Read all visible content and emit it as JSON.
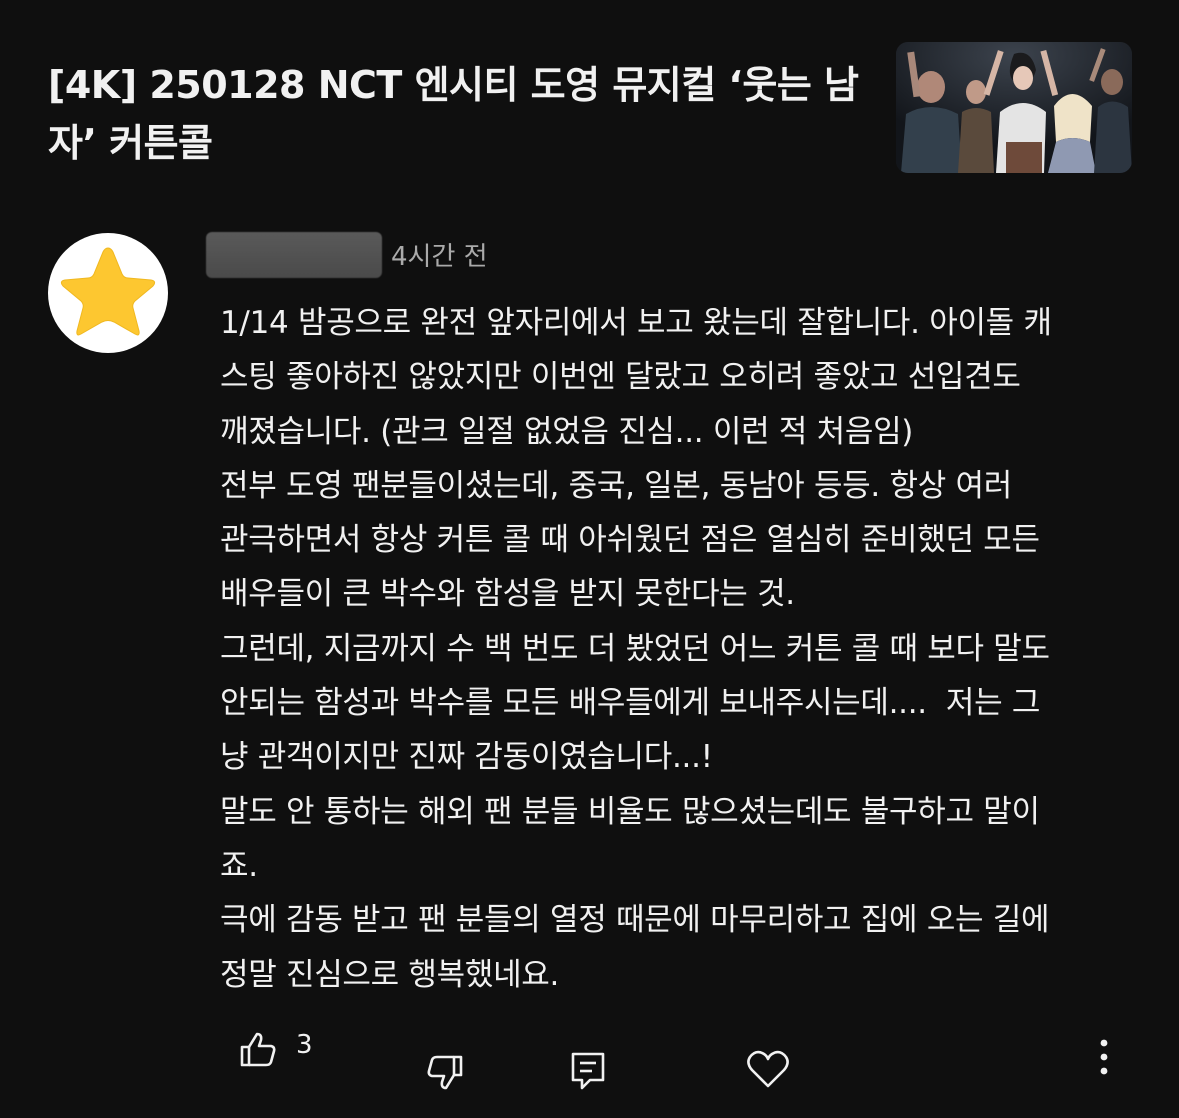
{
  "video": {
    "title": "[4K] 250128 NCT 엔시티 도영 뮤지컬 ‘웃는 남자’ 커튼콜"
  },
  "comment": {
    "avatar_icon": "star-icon",
    "timestamp": "4시간 전",
    "body": "1/14 밤공으로 완전 앞자리에서 보고 왔는데 잘합니다. 아이돌 캐\n스팅 좋아하진 않았지만 이번엔 달랐고 오히려 좋았고 선입견도\n깨졌습니다. (관크 일절 없었음 진심... 이런 적 처음임)\n전부 도영 팬분들이셨는데, 중국, 일본, 동남아 등등. 항상 여러\n관극하면서 항상 커튼 콜 때 아쉬웠던 점은 열심히 준비했던 모든\n배우들이 큰 박수와 함성을 받지 못한다는 것.\n그런데, 지금까지 수 백 번도 더 봤었던 어느 커튼 콜 때 보다 말도\n안되는 함성과 박수를 모든 배우들에게 보내주시는데....  저는 그\n냥 관객이지만 진짜 감동이였습니다...!\n말도 안 통하는 해외 팬 분들 비율도 많으셨는데도 불구하고 말이\n죠.\n극에 감동 받고 팬 분들의 열정 때문에 마무리하고 집에 오는 길에\n정말 진심으로 행복했네요.",
    "likes": "3"
  },
  "actions": {
    "like_icon": "thumbs-up-icon",
    "dislike_icon": "thumbs-down-icon",
    "reply_icon": "reply-icon",
    "heart_icon": "heart-icon",
    "more_icon": "more-vertical-icon"
  },
  "colors": {
    "background": "#0f0f0f",
    "text": "#f1f1f1",
    "secondary_text": "#aaaaaa",
    "star": "#fdc730"
  }
}
